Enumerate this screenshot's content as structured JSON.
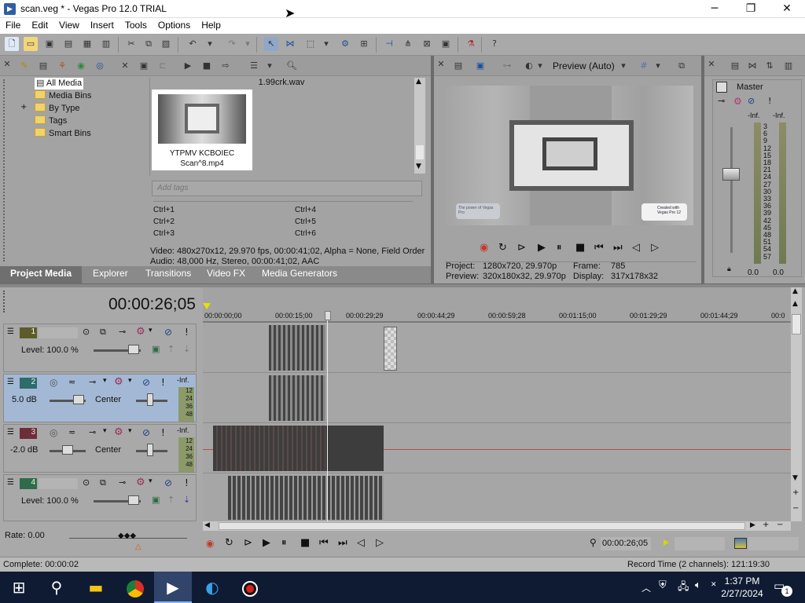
{
  "window": {
    "title": "scan.veg * - Vegas Pro 12.0 TRIAL",
    "minimize": "─",
    "maximize": "❐",
    "close": "✕"
  },
  "menu": [
    "File",
    "Edit",
    "View",
    "Insert",
    "Tools",
    "Options",
    "Help"
  ],
  "explorer": {
    "tree": [
      {
        "label": "All Media",
        "selected": true
      },
      {
        "label": "Media Bins"
      },
      {
        "label": "By Type",
        "expander": "+"
      },
      {
        "label": "Tags"
      },
      {
        "label": "Smart Bins"
      }
    ],
    "media_items": [
      {
        "name": "1.99crk.wav"
      },
      {
        "name": "YTPMV KCBOIEC\nScan^8.mp4",
        "line1": "YTPMV KCBOIEC",
        "line2": "Scan^8.mp4"
      }
    ],
    "tags_placeholder": "Add tags",
    "shortcuts": [
      "Ctrl+1",
      "Ctrl+4",
      "Ctrl+2",
      "Ctrl+5",
      "Ctrl+3",
      "Ctrl+6"
    ],
    "info_video": "Video: 480x270x12, 29.970 fps, 00:00:41;02, Alpha = None, Field Order",
    "info_audio": "Audio: 48,000 Hz, Stereo, 00:00:41;02, AAC",
    "tabs": [
      "Project Media",
      "Explorer",
      "Transitions",
      "Video FX",
      "Media Generators"
    ],
    "active_tab": "Project Media"
  },
  "preview": {
    "mode_label": "Preview (Auto)",
    "project_label": "Project:",
    "project_value": "1280x720, 29.970p",
    "preview_label": "Preview:",
    "preview_value": "320x180x32, 29.970p",
    "frame_label": "Frame:",
    "frame_value": "785",
    "display_label": "Display:",
    "display_value": "317x178x32",
    "watermark_left": "The power of Vegas Pro",
    "watermark_right": "Created with Vegas Pro 12"
  },
  "mixer": {
    "title": "Master",
    "left_peak": "-Inf.",
    "right_peak": "-Inf.",
    "scale": [
      "3",
      "6",
      "9",
      "12",
      "15",
      "18",
      "21",
      "24",
      "27",
      "30",
      "33",
      "36",
      "39",
      "42",
      "45",
      "48",
      "51",
      "54",
      "57"
    ],
    "left_value": "0.0",
    "right_value": "0.0"
  },
  "timeline": {
    "time_display": "00:00:26;05",
    "ruler": [
      "00:00:00;00",
      "00:00:15;00",
      "00:00:29;29",
      "00:00:44;29",
      "00:00:59;28",
      "00:01:15;00",
      "00:01:29;29",
      "00:01:44;29",
      "00:0"
    ],
    "tracks": [
      {
        "num": "1",
        "type": "video",
        "level_label": "Level: 100.0 %",
        "color": "#5c5c2a"
      },
      {
        "num": "2",
        "type": "audio",
        "vol": "5.0 dB",
        "pan": "Center",
        "peak": "-Inf.",
        "meter": [
          "12",
          "24",
          "36",
          "48"
        ],
        "color": "#2f6b6b"
      },
      {
        "num": "3",
        "type": "audio",
        "vol": "-2.0 dB",
        "pan": "Center",
        "peak": "-Inf.",
        "meter": [
          "12",
          "24",
          "36",
          "48"
        ],
        "color": "#6b2f3a"
      },
      {
        "num": "4",
        "type": "video",
        "level_label": "Level: 100.0 %",
        "color": "#2f6b4a"
      }
    ],
    "rate": "Rate: 0.00",
    "transport_time": "00:00:26;05"
  },
  "status": {
    "complete": "Complete: 00:00:02",
    "record_time": "Record Time (2 channels): 121:19:30"
  },
  "taskbar": {
    "time": "1:37 PM",
    "date": "2/27/2024",
    "notification_count": "1"
  }
}
